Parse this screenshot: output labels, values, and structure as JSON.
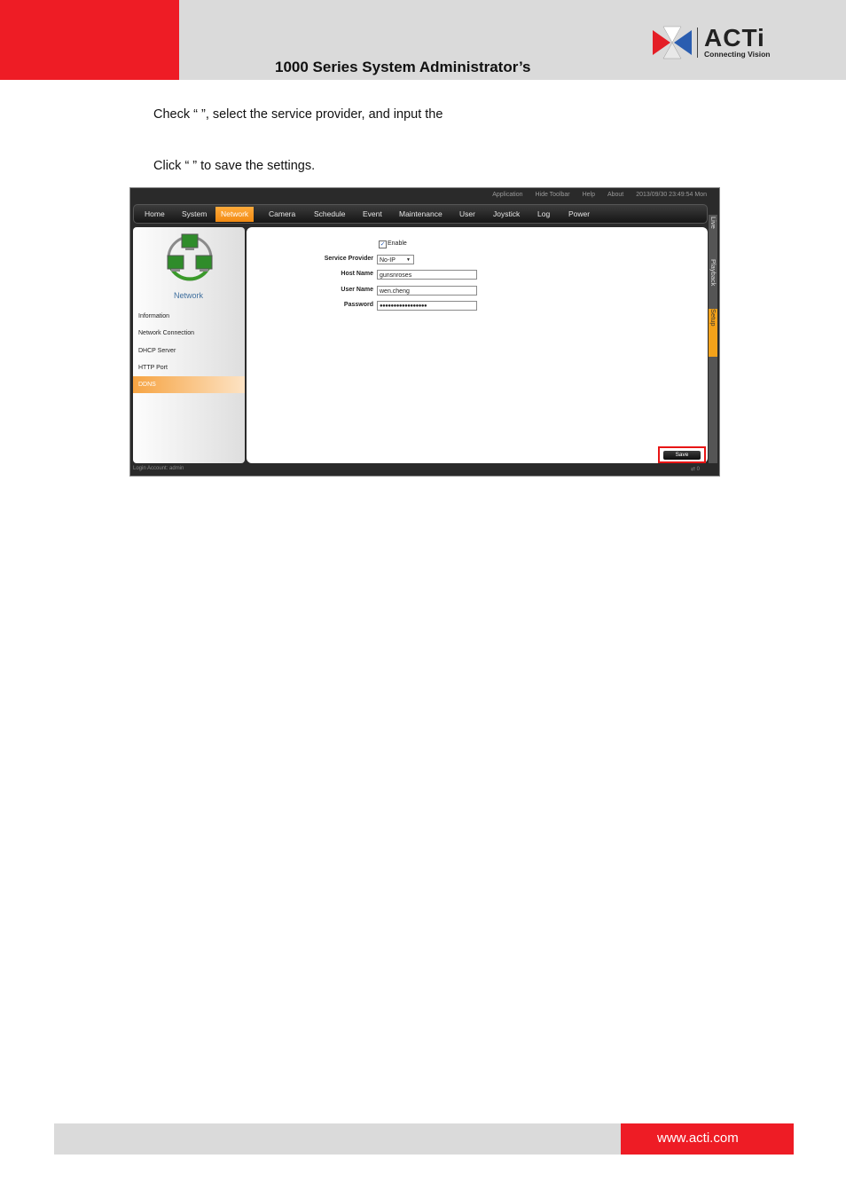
{
  "header": {
    "title": "1000 Series System Administrator’s",
    "brand": "ACTi",
    "tagline": "Connecting Vision"
  },
  "instructions": [
    "Check “           ”, select the service provider, and input the",
    "Click “        ” to save the settings."
  ],
  "app": {
    "top_links": [
      "Application",
      "Hide Toolbar",
      "Help",
      "About",
      "2013/09/30 23:49:54 Mon"
    ],
    "nav": [
      "Home",
      "System",
      "Network",
      "Camera",
      "Schedule",
      "Event",
      "Maintenance",
      "User",
      "Joystick",
      "Log",
      "Power"
    ],
    "active_nav": "Network",
    "side_tabs": [
      "Live",
      "Playback",
      "Setup"
    ],
    "left_title": "Network",
    "left_menu": [
      "Information",
      "Network Connection",
      "DHCP Server",
      "HTTP Port",
      "DDNS"
    ],
    "active_left": "DDNS",
    "form": {
      "enable_label": "Enable",
      "enable_checked": true,
      "service_provider_label": "Service Provider",
      "service_provider_value": "No-IP",
      "host_name_label": "Host Name",
      "host_name_value": "gunsnroses",
      "user_name_label": "User Name",
      "user_name_value": "wen.cheng",
      "password_label": "Password",
      "password_value": "●●●●●●●●●●●●●●●●●"
    },
    "save_label": "Save",
    "login_account": "Login Account: admin",
    "status_right": "0"
  },
  "footer": {
    "url": "www.acti.com"
  },
  "colors": {
    "brand_red": "#ee1c25",
    "accent_orange": "#f28a12",
    "header_gray": "#dadada"
  }
}
